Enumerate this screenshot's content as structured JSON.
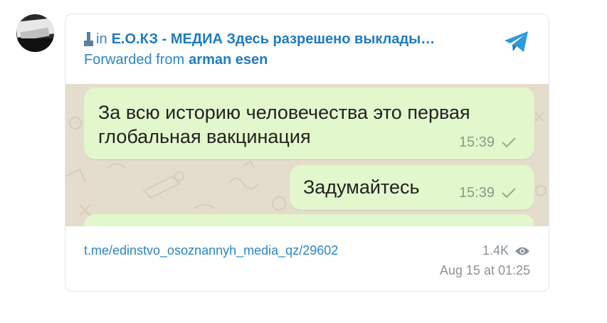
{
  "header": {
    "in_label": "in",
    "channel_name": "Е.О.КЗ - МЕДИА Здесь разрешено выклады…",
    "forwarded_label": "Forwarded from",
    "forwarded_author": "arman esen",
    "brand_color": "#2c86c7"
  },
  "messages": [
    {
      "text": "За всю историю человечества это первая глобальная вакцинация",
      "time": "15:39",
      "status": "check-icon"
    },
    {
      "text": "Задумайтесь",
      "time": "15:39",
      "status": "check-icon"
    }
  ],
  "footer": {
    "link": "t.me/edinstvo_osoznannyh_media_qz/29602",
    "views": "1.4K",
    "date": "Aug 15 at 01:25"
  },
  "colors": {
    "bubble": "#e2f7cb",
    "chat_background": "#e4ddcd",
    "muted_text": "#8a939b"
  }
}
